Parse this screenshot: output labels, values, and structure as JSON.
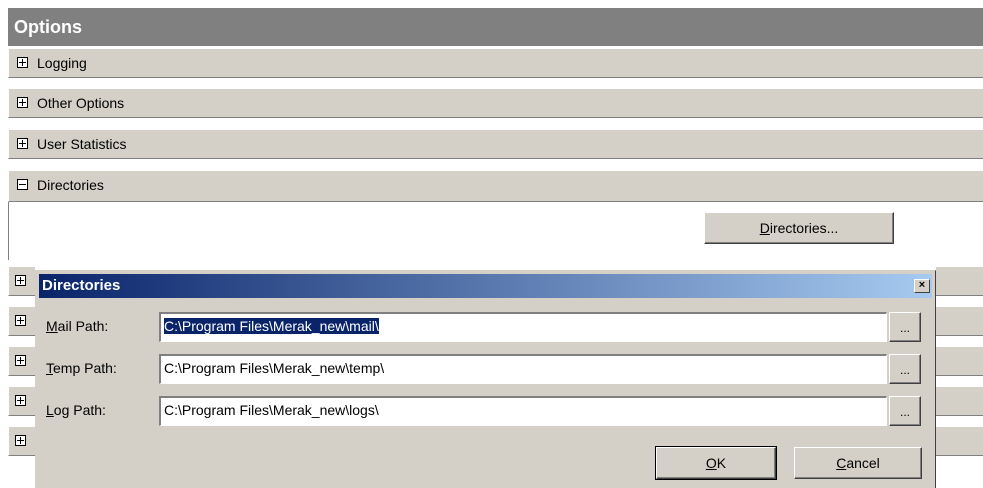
{
  "panel": {
    "title": "Options",
    "sections": [
      {
        "label": "Logging",
        "state": "collapsed"
      },
      {
        "label": "Other Options",
        "state": "collapsed"
      },
      {
        "label": "User Statistics",
        "state": "collapsed"
      },
      {
        "label": "Directories",
        "state": "expanded"
      }
    ],
    "directories_button": {
      "mnemonic": "D",
      "rest": "irectories..."
    }
  },
  "dialog": {
    "title": "Directories",
    "close_glyph": "×",
    "mail": {
      "label_mn": "M",
      "label_rest": "ail Path:",
      "value": "C:\\Program Files\\Merak_new\\mail\\"
    },
    "temp": {
      "label_mn": "T",
      "label_rest": "emp Path:",
      "value": "C:\\Program Files\\Merak_new\\temp\\"
    },
    "log": {
      "label_mn": "L",
      "label_rest": "og Path:",
      "value": "C:\\Program Files\\Merak_new\\logs\\"
    },
    "browse_label": "...",
    "ok": {
      "mnemonic": "O",
      "rest": "K"
    },
    "cancel": {
      "mnemonic": "C",
      "rest": "ancel"
    }
  }
}
